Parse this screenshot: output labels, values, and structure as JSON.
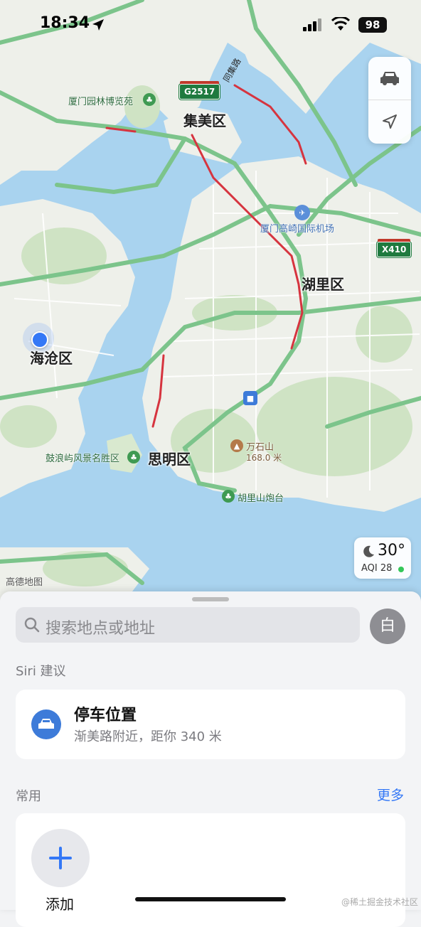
{
  "status_bar": {
    "time": "18:34",
    "battery": "98"
  },
  "map": {
    "districts": {
      "jimei": "集美区",
      "huli": "湖里区",
      "haicang": "海沧区",
      "siming": "思明区"
    },
    "pois": {
      "garden_expo": "厦门园林博览苑",
      "airport": "厦门高崎国际机场",
      "gulangyu": "鼓浪屿风景名胜区",
      "wanshishan": "万石山",
      "wanshishan_height": "168.0 米",
      "hulishan": "胡里山炮台"
    },
    "road_shields": {
      "g2517": "G2517",
      "x410": "X410"
    },
    "road_label": "同集路",
    "attribution": "高德地图",
    "colors": {
      "water": "#a9d3ef",
      "land": "#eef0ea",
      "green": "#cfe3c4",
      "highway": "#7cc48b",
      "traffic": "#d6343f"
    }
  },
  "weather": {
    "temperature": "30°",
    "aqi": "AQI 28"
  },
  "sheet": {
    "search_placeholder": "搜索地点或地址",
    "avatar_letter": "白",
    "siri_section": "Siri 建议",
    "suggestion": {
      "title": "停车位置",
      "subtitle": "渐美路附近，距你 340 米"
    },
    "favorites_section": "常用",
    "more_label": "更多",
    "add_label": "添加"
  },
  "footer_watermark": "@稀土掘金技术社区"
}
